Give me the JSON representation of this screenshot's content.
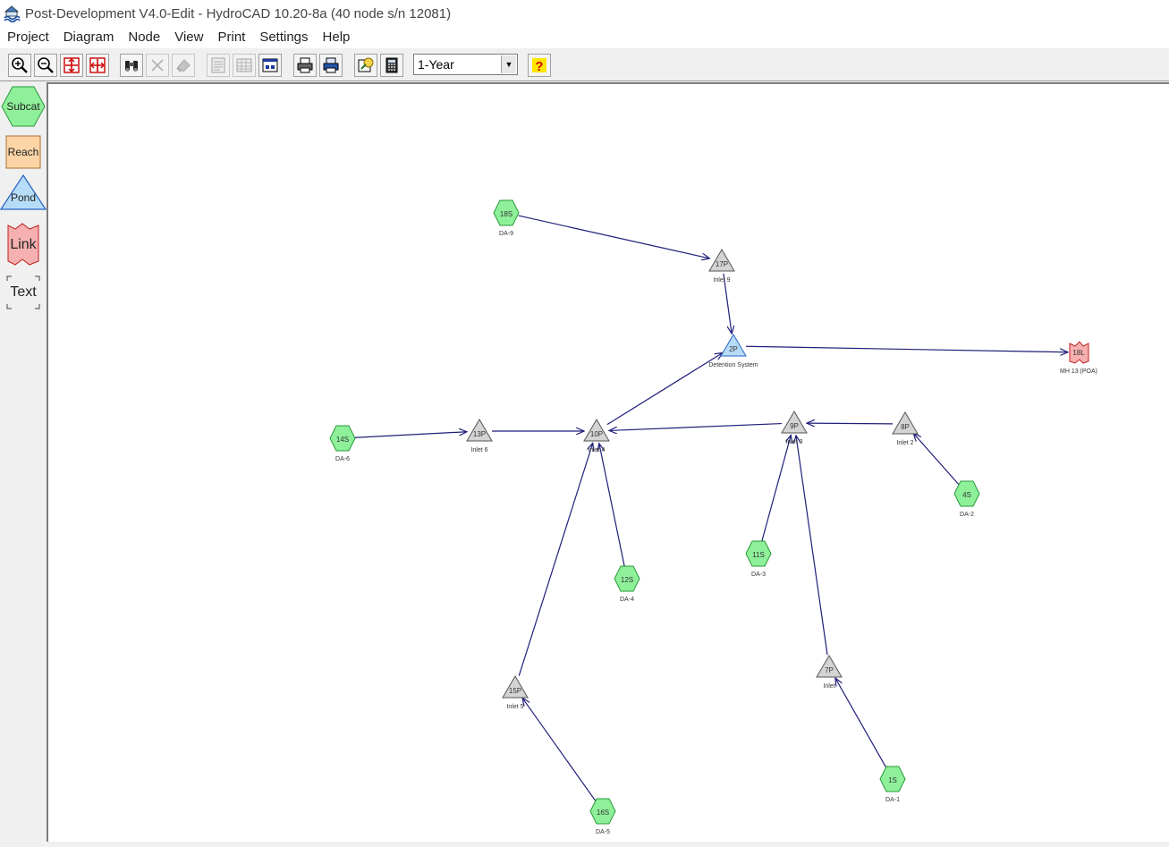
{
  "window": {
    "title": "Post-Development V4.0-Edit - HydroCAD 10.20-8a (40 node s/n 12081)"
  },
  "menu": [
    "Project",
    "Diagram",
    "Node",
    "View",
    "Print",
    "Settings",
    "Help"
  ],
  "toolbar": {
    "storm_event": "1-Year",
    "buttons": [
      "zoom-in-icon",
      "zoom-out-icon",
      "zoom-fit-icon",
      "zoom-all-icon",
      "find-icon",
      "delete-icon",
      "clear-icon",
      "report-icon",
      "table-icon",
      "window-icon",
      "print-icon",
      "print-setup-icon",
      "settings-icon",
      "calculator-icon",
      "help-icon"
    ]
  },
  "palette": {
    "subcat": "Subcat",
    "reach": "Reach",
    "pond": "Pond",
    "link": "Link",
    "text": "Text"
  },
  "nodes": [
    {
      "id": "18S",
      "type": "subcat",
      "label": "DA-9"
    },
    {
      "id": "17P",
      "type": "pond",
      "label": "Inlet 9"
    },
    {
      "id": "2P",
      "type": "pond-blue",
      "label": "Detention System"
    },
    {
      "id": "18L",
      "type": "link",
      "label": "MH 13 (POA)"
    },
    {
      "id": "14S",
      "type": "subcat",
      "label": "DA-6"
    },
    {
      "id": "13P",
      "type": "pond",
      "label": "Inlet 6"
    },
    {
      "id": "10P",
      "type": "pond",
      "label": "Inlet 4"
    },
    {
      "id": "9P",
      "type": "pond",
      "label": "Inlet 3"
    },
    {
      "id": "8P",
      "type": "pond",
      "label": "Inlet 2"
    },
    {
      "id": "4S",
      "type": "subcat",
      "label": "DA-2"
    },
    {
      "id": "11S",
      "type": "subcat",
      "label": "DA-3"
    },
    {
      "id": "12S",
      "type": "subcat",
      "label": "DA-4"
    },
    {
      "id": "15P",
      "type": "pond",
      "label": "Inlet 5"
    },
    {
      "id": "16S",
      "type": "subcat",
      "label": "DA-5"
    },
    {
      "id": "7P",
      "type": "pond",
      "label": "Inlet"
    },
    {
      "id": "1S",
      "type": "subcat",
      "label": "DA-1"
    }
  ],
  "links": [
    [
      "18S",
      "17P"
    ],
    [
      "17P",
      "2P"
    ],
    [
      "2P",
      "18L"
    ],
    [
      "14S",
      "13P"
    ],
    [
      "13P",
      "10P"
    ],
    [
      "10P",
      "2P"
    ],
    [
      "9P",
      "10P"
    ],
    [
      "8P",
      "9P"
    ],
    [
      "4S",
      "8P"
    ],
    [
      "11S",
      "9P"
    ],
    [
      "7P",
      "9P"
    ],
    [
      "12S",
      "10P"
    ],
    [
      "15P",
      "10P"
    ],
    [
      "16S",
      "15P"
    ],
    [
      "1S",
      "7P"
    ]
  ],
  "colors": {
    "subcat_fill": "#8ff09a",
    "pond_fill": "#d4d4d4",
    "detention_fill": "#b7dcf7",
    "link_fill": "#f7b0b0",
    "edge": "#1f1f7a"
  }
}
